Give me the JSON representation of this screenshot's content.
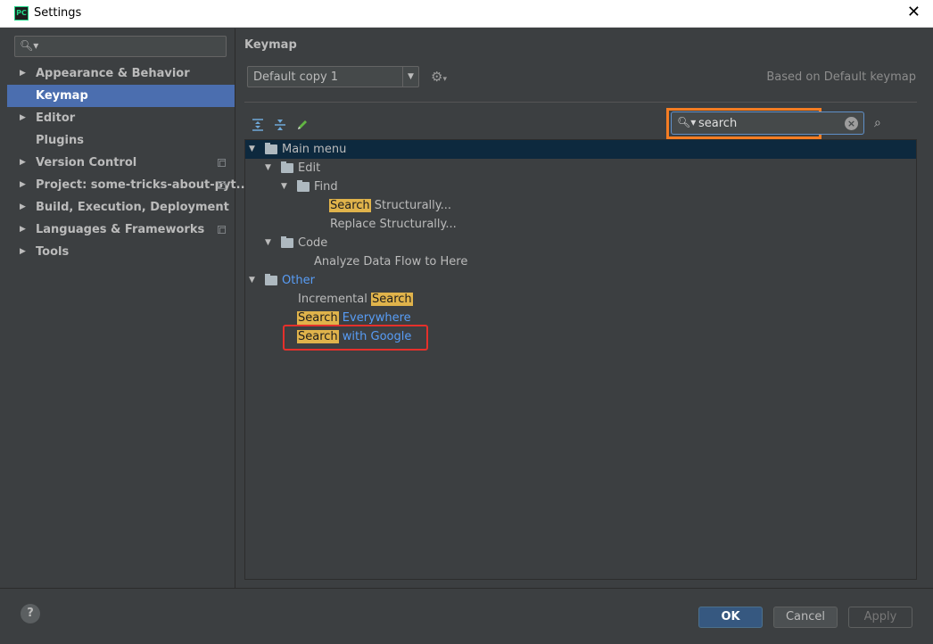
{
  "window": {
    "title": "Settings",
    "app_icon_text": "PC"
  },
  "sidebar": {
    "search_placeholder": "",
    "items": [
      {
        "label": "Appearance & Behavior",
        "expandable": true,
        "selected": false,
        "project_scope": false
      },
      {
        "label": "Keymap",
        "expandable": false,
        "selected": true,
        "project_scope": false
      },
      {
        "label": "Editor",
        "expandable": true,
        "selected": false,
        "project_scope": false
      },
      {
        "label": "Plugins",
        "expandable": false,
        "selected": false,
        "project_scope": false
      },
      {
        "label": "Version Control",
        "expandable": true,
        "selected": false,
        "project_scope": true
      },
      {
        "label": "Project: some-tricks-about-pyt...",
        "expandable": true,
        "selected": false,
        "project_scope": true
      },
      {
        "label": "Build, Execution, Deployment",
        "expandable": true,
        "selected": false,
        "project_scope": false
      },
      {
        "label": "Languages & Frameworks",
        "expandable": true,
        "selected": false,
        "project_scope": true
      },
      {
        "label": "Tools",
        "expandable": true,
        "selected": false,
        "project_scope": false
      }
    ]
  },
  "main": {
    "title": "Keymap",
    "keymap_select": "Default copy 1",
    "based_on": "Based on Default keymap",
    "search_value": "search",
    "tree": [
      {
        "text": "Main menu",
        "highlight": "",
        "rest": "",
        "rest_blue": false
      },
      {
        "text": "Edit",
        "highlight": "",
        "rest": "",
        "rest_blue": false
      },
      {
        "text": "Find",
        "highlight": "",
        "rest": "",
        "rest_blue": false
      },
      {
        "text": "",
        "highlight": "Search",
        "rest": " Structurally...",
        "rest_blue": false
      },
      {
        "text": "Replace Structurally...",
        "highlight": "",
        "rest": "",
        "rest_blue": false
      },
      {
        "text": "Code",
        "highlight": "",
        "rest": "",
        "rest_blue": false
      },
      {
        "text": "Analyze Data Flow to Here",
        "highlight": "",
        "rest": "",
        "rest_blue": false
      },
      {
        "text": "Other",
        "highlight": "",
        "rest": "",
        "rest_blue": true
      },
      {
        "text": "Incremental ",
        "highlight": "Search",
        "rest": "",
        "rest_blue": false
      },
      {
        "text": "",
        "highlight": "Search",
        "rest": " Everywhere",
        "rest_blue": true
      },
      {
        "text": "",
        "highlight": "Search",
        "rest": " with Google",
        "rest_blue": true
      }
    ]
  },
  "footer": {
    "help_label": "?",
    "ok_label": "OK",
    "cancel_label": "Cancel",
    "apply_label": "Apply"
  },
  "colors": {
    "accent": "#4b6eaf",
    "highlight": "#e0b34b",
    "search_annotation": "#f57d23",
    "result_annotation": "#e5302b",
    "link_blue": "#589df6"
  }
}
